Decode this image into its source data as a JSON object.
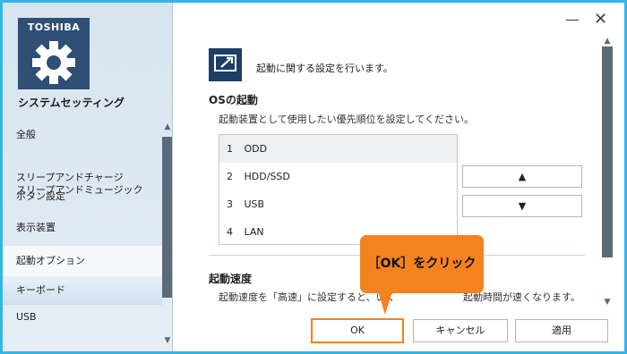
{
  "app": {
    "brand": "TOSHIBA",
    "title": "システムセッティング"
  },
  "sidebar": {
    "items": [
      {
        "label": "全般"
      },
      {
        "label": "スリープアンドチャージ\nスリープアンドミュージック"
      },
      {
        "label": "ボタン設定"
      },
      {
        "label": "表示装置"
      },
      {
        "label": "起動オプション",
        "selected": true
      },
      {
        "label": "キーボード"
      },
      {
        "label": "USB"
      }
    ]
  },
  "window": {
    "minimize_icon": "minus-icon",
    "close_icon": "close-icon"
  },
  "main": {
    "intro": "起動に関する設定を行います。",
    "os_boot": {
      "title": "OSの起動",
      "description": "起動装置として使用したい優先順位を設定してください。",
      "devices": [
        {
          "num": "1",
          "name": "ODD",
          "selected": true
        },
        {
          "num": "2",
          "name": "HDD/SSD"
        },
        {
          "num": "3",
          "name": "USB"
        },
        {
          "num": "4",
          "name": "LAN"
        }
      ],
      "up_icon": "▲",
      "down_icon": "▼"
    },
    "boot_speed": {
      "title": "起動速度",
      "description_start": "起動速度を「高速」に設定すると、いく",
      "description_end": "起動時間が速くなります。"
    }
  },
  "buttons": {
    "ok": "OK",
    "cancel": "キャンセル",
    "apply": "適用"
  },
  "annotation": {
    "text": "［OK］をクリック",
    "color": "#f58220"
  },
  "colors": {
    "frame": "#33b5e5",
    "tile": "#2f4f74",
    "accent": "#f58220"
  }
}
